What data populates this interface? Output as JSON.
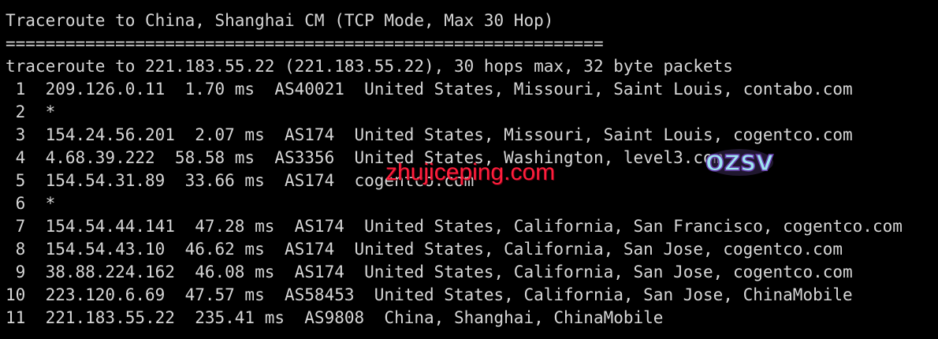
{
  "terminal": {
    "title_line": "Traceroute to China, Shanghai CM (TCP Mode, Max 30 Hop)",
    "separator_line": "============================================================",
    "header_line": "traceroute to 221.183.55.22 (221.183.55.22), 30 hops max, 32 byte packets",
    "hops": [
      " 1  209.126.0.11  1.70 ms  AS40021  United States, Missouri, Saint Louis, contabo.com",
      " 2  *",
      " 3  154.24.56.201  2.07 ms  AS174  United States, Missouri, Saint Louis, cogentco.com",
      " 4  4.68.39.222  58.58 ms  AS3356  United States, Washington, level3.com",
      " 5  154.54.31.89  33.66 ms  AS174  cogentco.com",
      " 6  *",
      " 7  154.54.44.141  47.28 ms  AS174  United States, California, San Francisco, cogentco.com",
      " 8  154.54.43.10  46.62 ms  AS174  United States, California, San Jose, cogentco.com",
      " 9  38.88.224.162  46.08 ms  AS174  United States, California, San Jose, cogentco.com",
      "10  223.120.6.69  47.57 ms  AS58453  United States, California, San Jose, ChinaMobile",
      "11  221.183.55.22  235.41 ms  AS9808  China, Shanghai, ChinaMobile"
    ]
  },
  "watermark": {
    "text": "zhujiceping.com",
    "logo_text": "OZSV"
  }
}
